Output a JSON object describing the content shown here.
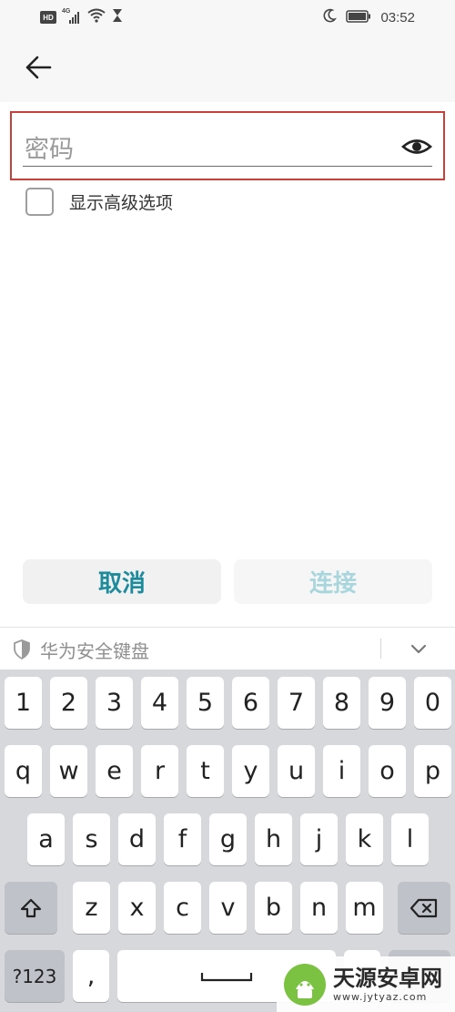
{
  "status_bar": {
    "hd": "HD",
    "network": "4G",
    "time": "03:52",
    "icons": [
      "hd-icon",
      "signal-icon",
      "wifi-icon",
      "hourglass-icon",
      "moon-icon",
      "battery-icon"
    ]
  },
  "header": {
    "back_icon": "arrow-left-icon"
  },
  "password": {
    "placeholder": "密码",
    "value": "",
    "toggle_icon": "eye-icon"
  },
  "advanced": {
    "label": "显示高级选项",
    "checked": false
  },
  "dialog": {
    "cancel_label": "取消",
    "connect_label": "连接"
  },
  "keyboard": {
    "title": "华为安全键盘",
    "row_numbers": [
      "1",
      "2",
      "3",
      "4",
      "5",
      "6",
      "7",
      "8",
      "9",
      "0"
    ],
    "row1": [
      "q",
      "w",
      "e",
      "r",
      "t",
      "y",
      "u",
      "i",
      "o",
      "p"
    ],
    "row2": [
      "a",
      "s",
      "d",
      "f",
      "g",
      "h",
      "j",
      "k",
      "l"
    ],
    "row3": [
      "z",
      "x",
      "c",
      "v",
      "b",
      "n",
      "m"
    ],
    "symbols_label": "?123",
    "comma": ","
  },
  "watermark": {
    "name": "天源安卓网",
    "url": "www.jytyaz.com"
  },
  "colors": {
    "accent": "#1d8b9c",
    "accent_disabled": "#a9d6dd",
    "focus_border": "#c9403a",
    "keyboard_bg": "#d7d8dc"
  }
}
